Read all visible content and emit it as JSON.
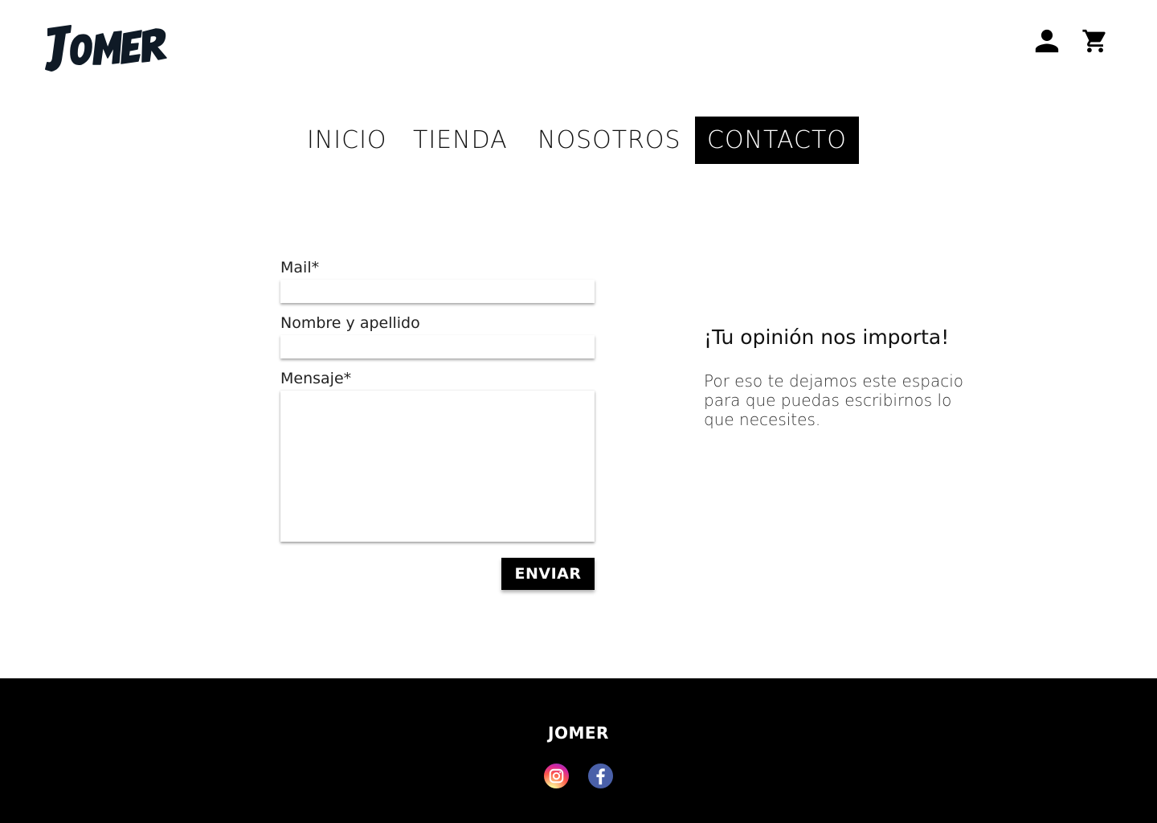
{
  "header": {
    "logo_text": "JOMER",
    "icons": [
      "user-icon",
      "cart-icon"
    ]
  },
  "nav": {
    "items": [
      {
        "label": "INICIO"
      },
      {
        "label": "TIENDA"
      },
      {
        "label": "NOSOTROS"
      },
      {
        "label": "CONTACTO",
        "active": true
      }
    ]
  },
  "form": {
    "mail_label": "Mail*",
    "mail_value": "",
    "name_label": "Nombre y apellido",
    "name_value": "",
    "message_label": "Mensaje*",
    "message_value": "",
    "submit_label": "ENVIAR"
  },
  "aside": {
    "title": "¡Tu opinión nos importa!",
    "text": "Por eso te dejamos este espacio para que puedas escribirnos lo que necesites."
  },
  "footer": {
    "brand": "JOMER",
    "social_icons": [
      "instagram-icon",
      "facebook-icon"
    ]
  },
  "colors": {
    "primary": "#000000",
    "background": "#ffffff",
    "logo": "#0f1a26",
    "facebook": "#4a60a8"
  }
}
